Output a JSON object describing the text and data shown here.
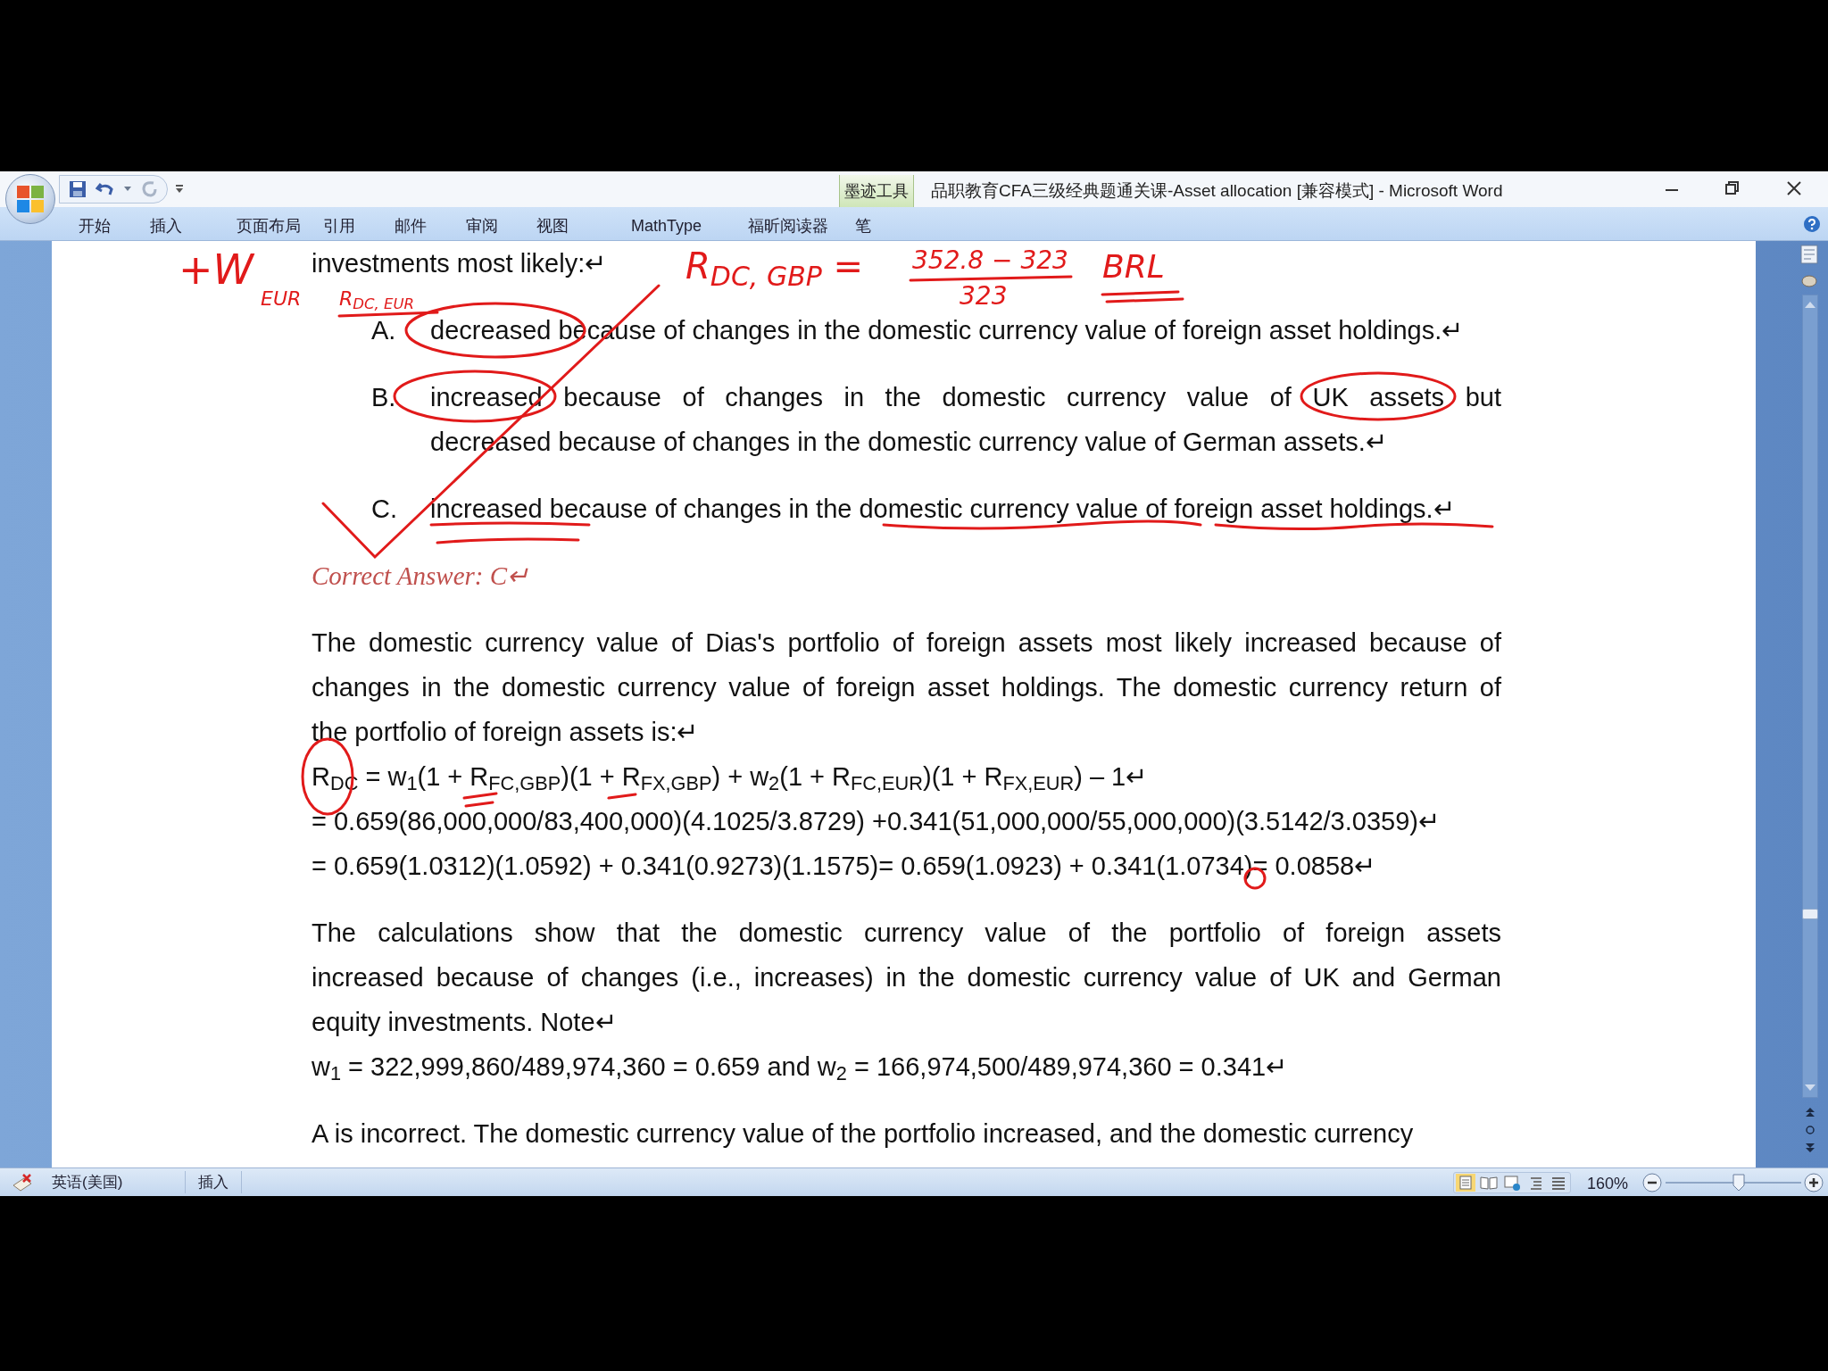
{
  "window": {
    "title": "品职教育CFA三级经典题通关课-Asset allocation [兼容模式] - Microsoft Word"
  },
  "ribbon": {
    "tabs": [
      "开始",
      "插入",
      "页面布局",
      "引用",
      "邮件",
      "审阅",
      "视图",
      "MathType",
      "福昕阅读器"
    ],
    "contextual_group": {
      "title": "墨迹工具",
      "tab": "笔"
    }
  },
  "document": {
    "blocks": [
      {
        "kind": "question",
        "lines": [
          "investments most likely:↵"
        ]
      },
      {
        "kind": "option",
        "label": "A.",
        "lines": [
          "decreased because of changes in the domestic currency value of foreign asset holdings.↵"
        ]
      },
      {
        "kind": "option",
        "label": "B.",
        "lines": [
          "increased because of changes in the domestic currency value of UK assets but",
          "decreased because of changes in the domestic currency value of German assets.↵"
        ]
      },
      {
        "kind": "option",
        "label": "C.",
        "lines": [
          "increased because of changes in the domestic currency value of foreign asset holdings.↵"
        ]
      },
      {
        "kind": "answer",
        "lines": [
          "Correct Answer: C↵"
        ]
      },
      {
        "kind": "paragraph",
        "lines": [
          "The domestic currency value of Dias's portfolio of foreign assets most likely increased because of",
          "changes in the domestic currency value of foreign asset holdings. The domestic currency return of",
          "the portfolio of foreign assets is:↵"
        ]
      },
      {
        "kind": "formula",
        "lines": [
          "R$_{DC}$ = w$_{1}$(1 + R$_{FC,GBP}$)(1 + R$_{FX,GBP}$) + w$_{2}$(1 + R$_{FC,EUR}$)(1 + R$_{FX,EUR}$) – 1↵",
          "= 0.659(86,000,000/83,400,000)(4.1025/3.8729)  +0.341(51,000,000/55,000,000)(3.5142/3.0359)↵",
          "= 0.659(1.0312)(1.0592)  + 0.341(0.9273)(1.1575)= 0.659(1.0923)  + 0.341(1.0734)= 0.0858↵"
        ]
      },
      {
        "kind": "paragraph",
        "lines": [
          "The calculations show that the domestic currency value of the portfolio of foreign assets",
          "increased because of changes (i.e., increases) in the domestic currency value of UK and German",
          "equity investments. Note↵"
        ]
      },
      {
        "kind": "formula",
        "lines": [
          "w$_{1}$ = 322,999,860/489,974,360  = 0.659 and w$_{2}$ = 166,974,500/489,974,360  = 0.341↵"
        ]
      },
      {
        "kind": "paragraph",
        "lines": [
          "A is incorrect. The domestic currency value of the portfolio increased, and the domestic currency"
        ]
      }
    ],
    "handwriting": [
      {
        "kind": "note",
        "text": "+W"
      },
      {
        "kind": "small",
        "text": "EUR"
      },
      {
        "kind": "note",
        "text": "R$_{DC, EUR}$"
      },
      {
        "kind": "note",
        "text": "R$_{DC, GBP}$ ="
      },
      {
        "kind": "note",
        "text": "352.8 − 323"
      },
      {
        "kind": "note",
        "text": "323"
      },
      {
        "kind": "note",
        "text": "BRL"
      }
    ]
  },
  "status_bar": {
    "language": "英语(美国)",
    "mode": "插入",
    "zoom": "160%"
  }
}
